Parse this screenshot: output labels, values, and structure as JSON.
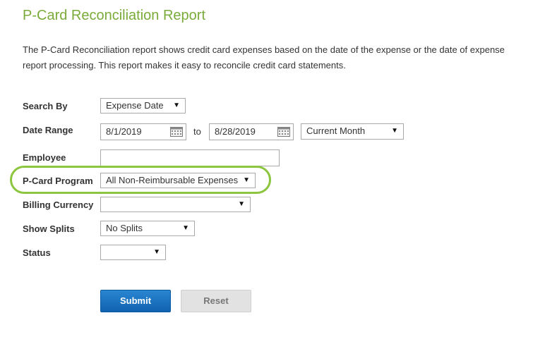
{
  "page": {
    "title": "P-Card Reconciliation Report",
    "description": "The P-Card Reconciliation report shows credit card expenses based on the date of the expense or the date of expense report processing. This report makes it easy to reconcile credit card statements."
  },
  "form": {
    "search_by": {
      "label": "Search By",
      "value": "Expense Date"
    },
    "date_range": {
      "label": "Date Range",
      "start": "8/1/2019",
      "to": "to",
      "end": "8/28/2019",
      "period": "Current Month"
    },
    "employee": {
      "label": "Employee",
      "value": ""
    },
    "pcard_program": {
      "label": "P-Card Program",
      "value": "All Non-Reimbursable Expenses"
    },
    "billing_currency": {
      "label": "Billing Currency",
      "value": ""
    },
    "show_splits": {
      "label": "Show Splits",
      "value": "No Splits"
    },
    "status": {
      "label": "Status",
      "value": ""
    }
  },
  "buttons": {
    "submit": "Submit",
    "reset": "Reset"
  },
  "colors": {
    "title": "#7aab3a",
    "highlight": "#8cc63e",
    "primary": "#1a73c2"
  },
  "icons": {
    "date_picker": "calendar-icon",
    "dropdown": "chevron-down-icon"
  }
}
